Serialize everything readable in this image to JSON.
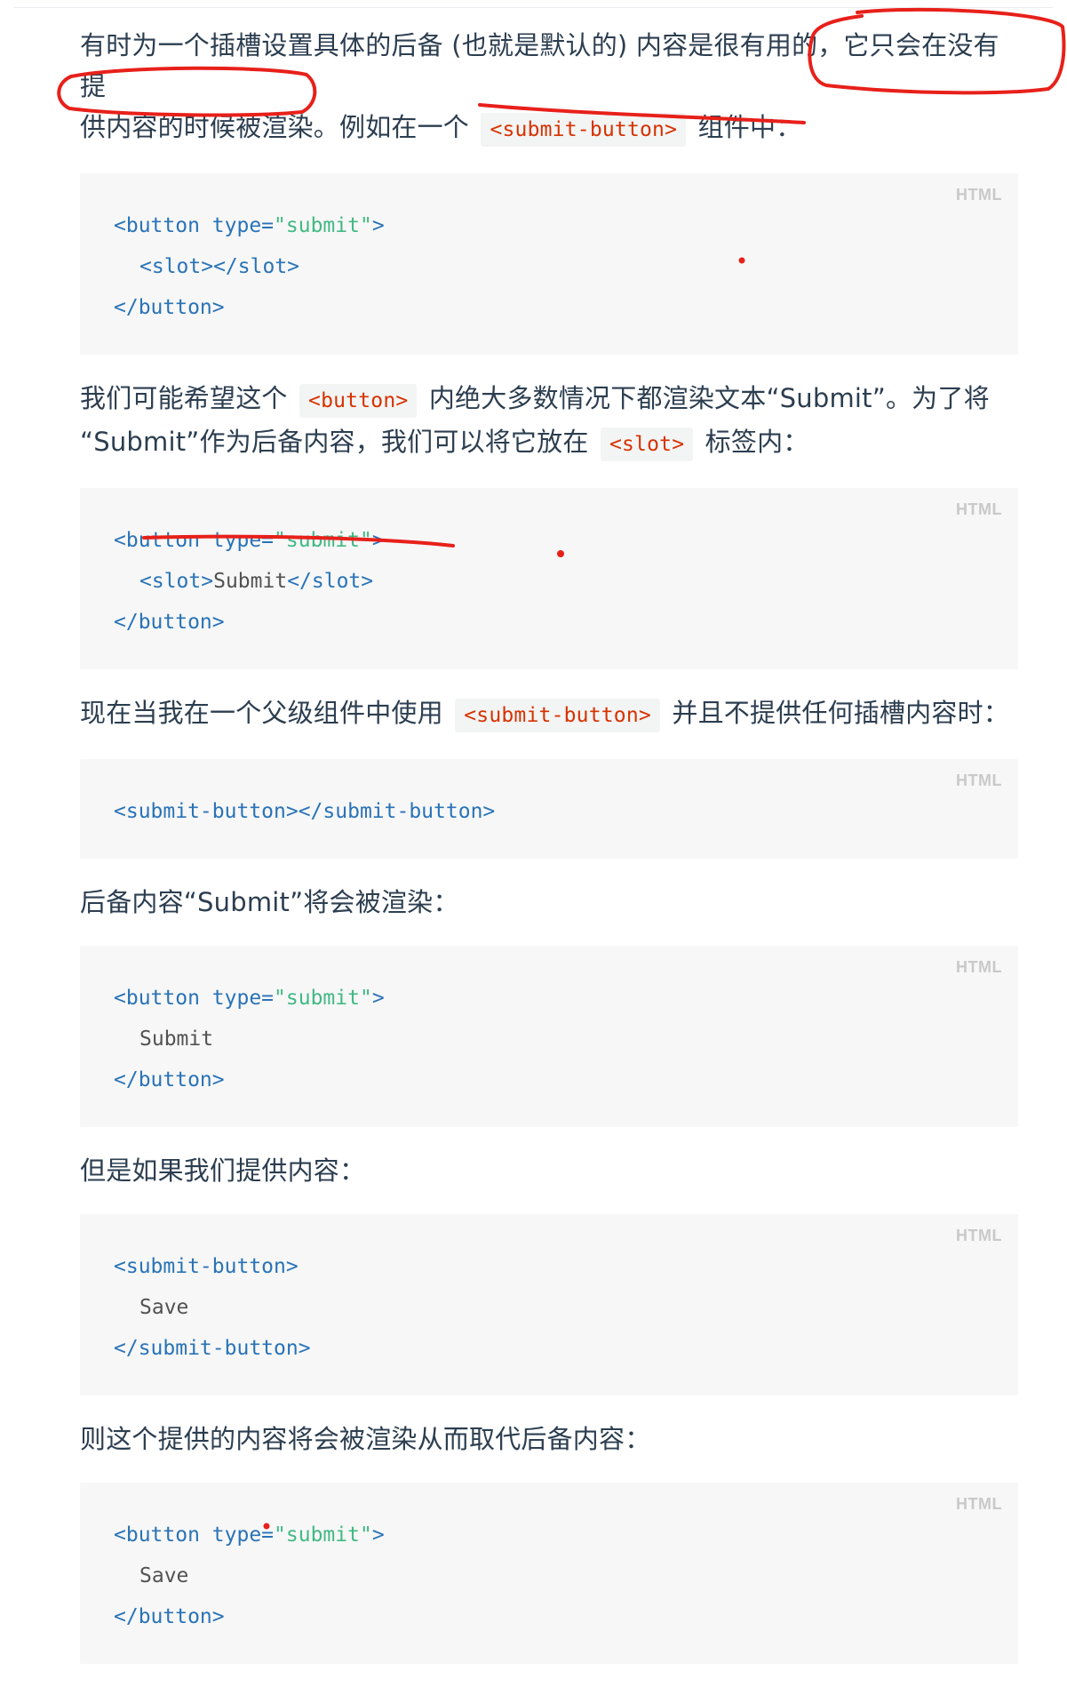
{
  "paragraphs": {
    "p1_a": "有时为一个插槽设置具体的后备 (也就是默认的) 内容是很有用的，它只会在没有提",
    "p1_b": "供内容的时候被渲染。例如在一个",
    "p1_code": "<submit-button>",
    "p1_c": "组件中：",
    "p2_a": "我们可能希望这个",
    "p2_code": "<button>",
    "p2_b": "内绝大多数情况下都渲染文本“Submit”。为了将",
    "p2_c": "“Submit”作为后备内容，我们可以将它放在",
    "p2_code2": "<slot>",
    "p2_d": "标签内：",
    "p3_a": "现在当我在一个父级组件中使用",
    "p3_code": "<submit-button>",
    "p3_b": "并且不提供任何插槽内容时：",
    "p4": "后备内容“Submit”将会被渲染：",
    "p5": "但是如果我们提供内容：",
    "p6": "则这个提供的内容将会被渲染从而取代后备内容："
  },
  "code_blocks": [
    {
      "lang": "HTML",
      "lines": [
        {
          "tag_open": "<button ",
          "attr": "type=",
          "str": "\"submit\"",
          "tag_close": ">"
        },
        {
          "indent": true,
          "tag": "<slot></slot>"
        },
        {
          "tag": "</button>"
        }
      ]
    },
    {
      "lang": "HTML",
      "lines": [
        {
          "tag_open": "<button ",
          "attr": "type=",
          "str": "\"submit\"",
          "tag_close": ">"
        },
        {
          "indent": true,
          "tag_open": "<slot>",
          "text": "Submit",
          "tag_close": "</slot>"
        },
        {
          "tag": "</button>"
        }
      ]
    },
    {
      "lang": "HTML",
      "lines": [
        {
          "tag": "<submit-button></submit-button>"
        }
      ]
    },
    {
      "lang": "HTML",
      "lines": [
        {
          "tag_open": "<button ",
          "attr": "type=",
          "str": "\"submit\"",
          "tag_close": ">"
        },
        {
          "indent": true,
          "text": "Submit"
        },
        {
          "tag": "</button>"
        }
      ]
    },
    {
      "lang": "HTML",
      "lines": [
        {
          "tag": "<submit-button>"
        },
        {
          "indent": true,
          "text": "Save"
        },
        {
          "tag": "</submit-button>"
        }
      ]
    },
    {
      "lang": "HTML",
      "lines": [
        {
          "tag_open": "<button ",
          "attr": "type=",
          "str": "\"submit\"",
          "tag_close": ">"
        },
        {
          "indent": true,
          "text": "Save"
        },
        {
          "tag": "</button>"
        }
      ]
    }
  ],
  "annotation_color": "#e8201a"
}
